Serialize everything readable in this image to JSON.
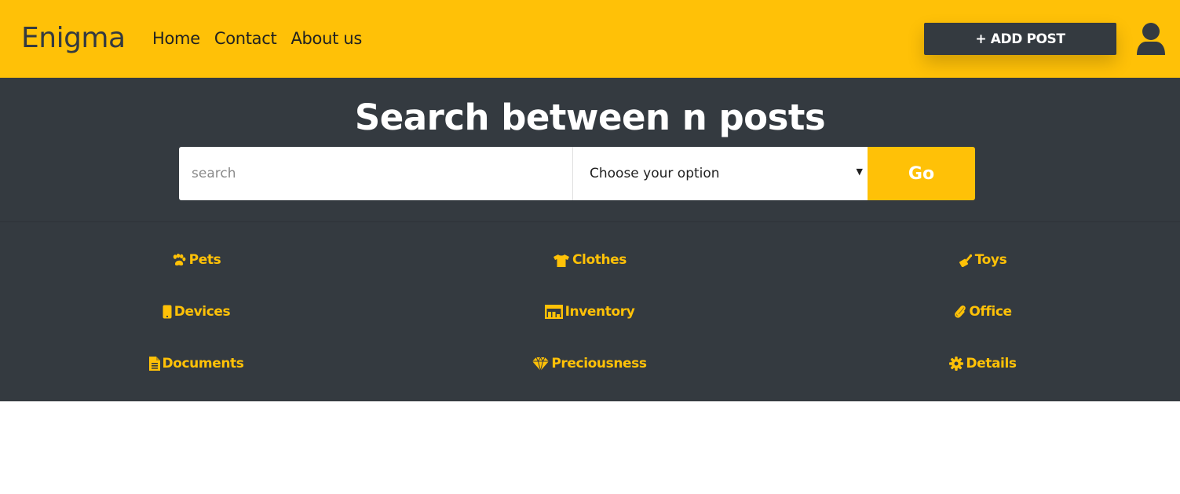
{
  "navbar": {
    "brand": "Enigma",
    "links": [
      {
        "label": "Home"
      },
      {
        "label": "Contact"
      },
      {
        "label": "About us"
      }
    ],
    "add_post_label": "+ ADD POST",
    "user_icon": "user-icon"
  },
  "hero": {
    "title": "Search between n posts",
    "search": {
      "placeholder": "search",
      "value": ""
    },
    "select": {
      "selected": "Choose your option"
    },
    "go_label": "Go"
  },
  "categories": [
    {
      "label": "Pets",
      "icon": "paw-icon"
    },
    {
      "label": "Clothes",
      "icon": "tshirt-icon"
    },
    {
      "label": "Toys",
      "icon": "toy-icon"
    },
    {
      "label": "Devices",
      "icon": "mobile-icon"
    },
    {
      "label": "Inventory",
      "icon": "warehouse-icon"
    },
    {
      "label": "Office",
      "icon": "paperclip-icon"
    },
    {
      "label": "Documents",
      "icon": "file-icon"
    },
    {
      "label": "Preciousness",
      "icon": "gem-icon"
    },
    {
      "label": "Details",
      "icon": "gear-icon"
    }
  ],
  "colors": {
    "accent": "#ffc107",
    "dark": "#343a40",
    "white": "#ffffff"
  }
}
